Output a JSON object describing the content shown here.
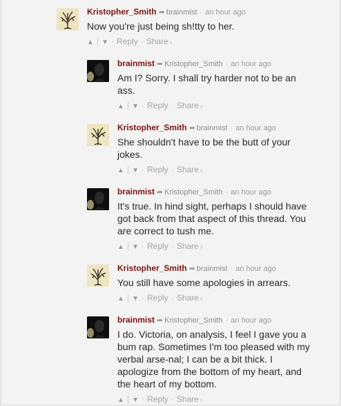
{
  "comments": [
    {
      "author": "Kristopher_Smith",
      "parent": "brainmist",
      "time": "an hour ago",
      "lines": [
        "Now you're just being sh!tty to her."
      ],
      "reply": "Reply",
      "share": "Share",
      "avatar_type": "tree"
    },
    {
      "author": "brainmist",
      "parent": "Kristopher_Smith",
      "time": "an hour ago",
      "lines": [
        "Am I? Sorry. I shall try harder not to be an",
        "ass."
      ],
      "reply": "Reply",
      "share": "Share",
      "avatar_type": "dark"
    },
    {
      "author": "Kristopher_Smith",
      "parent": "brainmist",
      "time": "an hour ago",
      "lines": [
        "She shouldn't have to be the butt of your",
        "jokes."
      ],
      "reply": "Reply",
      "share": "Share",
      "avatar_type": "tree"
    },
    {
      "author": "brainmist",
      "parent": "Kristopher_Smith",
      "time": "an hour ago",
      "lines": [
        "It's true. In hind sight, perhaps I should have",
        "got back from that aspect of this thread. You",
        "are correct to tush me."
      ],
      "reply": "Reply",
      "share": "Share",
      "avatar_type": "dark"
    },
    {
      "author": "Kristopher_Smith",
      "parent": "brainmist",
      "time": "an hour ago",
      "lines": [
        "You still have some apologies in arrears."
      ],
      "reply": "Reply",
      "share": "Share",
      "avatar_type": "tree"
    },
    {
      "author": "brainmist",
      "parent": "Kristopher_Smith",
      "time": "an hour ago",
      "lines": [
        "I do. Victoria, on analysis, I feel I gave you a",
        "bum rap. Sometimes I'm too pleased with my",
        "verbal arse-nal; I can be a bit thick. I",
        "apologize from the bottom of my heart, and",
        "the heart of my bottom."
      ],
      "reply": "Reply",
      "share": "Share",
      "avatar_type": "dark"
    }
  ],
  "colors": {
    "author": "#7a1414",
    "meta": "#9a9a9a",
    "background": "#f3f3f3"
  }
}
